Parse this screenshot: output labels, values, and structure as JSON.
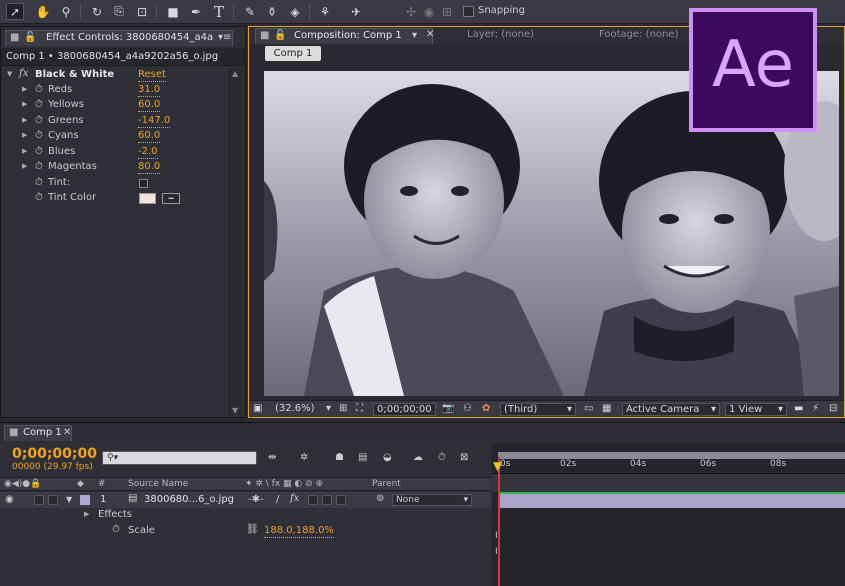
{
  "toolbar": {
    "snapping_label": "Snapping",
    "tools": [
      "selection-tool",
      "hand-tool",
      "zoom-tool",
      "rotate-tool",
      "camera-tool",
      "pan-behind-tool",
      "rectangle-tool",
      "pen-tool",
      "type-tool",
      "brush-tool",
      "clone-stamp-tool",
      "eraser-tool",
      "roto-brush-tool",
      "puppet-tool"
    ]
  },
  "effect_controls": {
    "tab_label": "Effect Controls: 3800680454_a4a",
    "subheader": "Comp 1 • 3800680454_a4a9202a56_o.jpg",
    "effect_name": "Black & White",
    "reset_label": "Reset",
    "fx_label": "fx",
    "params": [
      {
        "label": "Reds",
        "value": "31.0"
      },
      {
        "label": "Yellows",
        "value": "60.0"
      },
      {
        "label": "Greens",
        "value": "-147.0"
      },
      {
        "label": "Cyans",
        "value": "60.0"
      },
      {
        "label": "Blues",
        "value": "-2.0"
      },
      {
        "label": "Magentas",
        "value": "80.0"
      },
      {
        "label": "Tint:",
        "value": ""
      },
      {
        "label": "Tint Color",
        "value": ""
      }
    ],
    "tint_color": "#f2e4d6"
  },
  "composition": {
    "tab_label": "Composition: Comp 1",
    "layer_tab": "Layer: (none)",
    "footage_tab": "Footage: (none)",
    "inner_tab": "Comp 1",
    "zoom": "(32.6%)",
    "timecode": "0;00;00;00",
    "resolution": "(Third)",
    "camera": "Active Camera",
    "views": "1 View"
  },
  "logo": {
    "text": "Ae",
    "bg_color": "#3b0a5e",
    "border_color": "#cf8ff5",
    "text_color": "#d9a6ff"
  },
  "timeline": {
    "tab_label": "Comp 1",
    "timecode": "0;00;00;00",
    "fps": "00000 (29.97 fps)",
    "search_placeholder": "",
    "columns": {
      "number": "#",
      "source_name": "Source Name",
      "parent": "Parent"
    },
    "layer": {
      "number": "1",
      "name": "3800680...6_o.jpg",
      "parent": "None",
      "effects_label": "Effects",
      "scale_label": "Scale",
      "scale_value": "188.0,188.0%"
    },
    "ruler_ticks": [
      "0s",
      "02s",
      "04s",
      "06s",
      "08s"
    ],
    "playhead_color": "#d23a3a"
  }
}
